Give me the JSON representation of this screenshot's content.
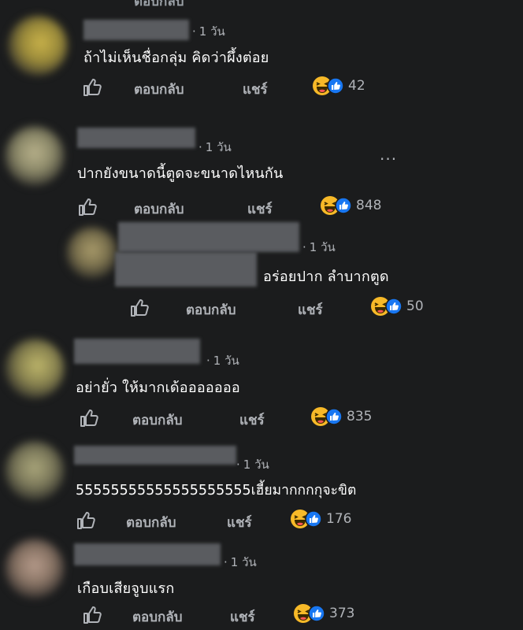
{
  "actions": {
    "reply_label": "ตอบกลับ",
    "share_label": "แชร์"
  },
  "icons": {
    "like": "thumbs-up-outline-icon",
    "haha": "haha-reaction-icon",
    "like_badge": "like-reaction-badge-icon",
    "more": "more-options-icon"
  },
  "colors": {
    "background": "#1b1c1d",
    "like_blue": "#1877f2",
    "haha_yellow": "#f7b928",
    "secondary_text": "#b0b3b8"
  },
  "comments": [
    {
      "time": "1 วัน",
      "text": "ถ้าไม่เห็นชื่อกลุ่ม คิดว่าผึ้งต่อย",
      "reaction_count": "42"
    },
    {
      "time": "1 วัน",
      "text": "ปากยังขนาดนี้ตูดจะขนาดไหนกัน",
      "reaction_count": "848",
      "more": "···"
    },
    {
      "time": "1 วัน",
      "text": "อร่อยปาก ลำบากตูด",
      "reaction_count": "50"
    },
    {
      "time": "1 วัน",
      "text": "อย่ายั่ว ให้มากเด้อออออออ",
      "reaction_count": "835"
    },
    {
      "time": "1 วัน",
      "text": "55555555555555555555เฮี้ยมากกกกุจะขิต",
      "reaction_count": "176"
    },
    {
      "time": "1 วัน",
      "text": "เกือบเสียจูบแรก",
      "reaction_count": "373"
    }
  ]
}
